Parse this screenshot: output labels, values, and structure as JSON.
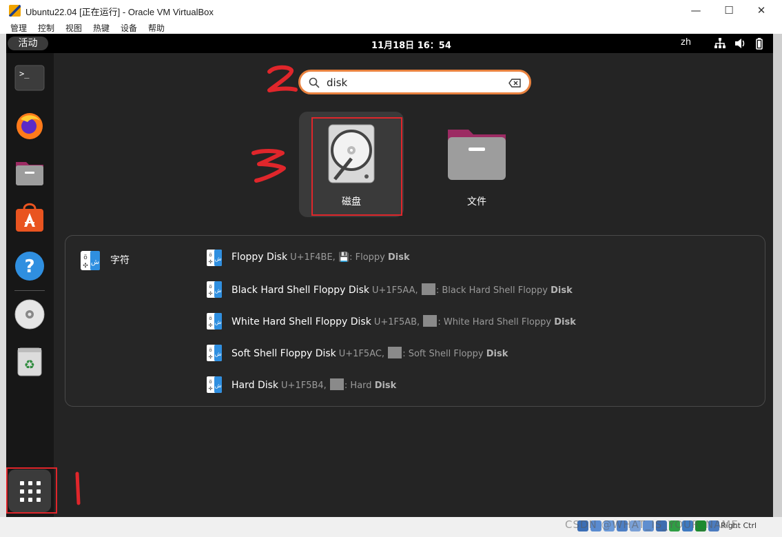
{
  "window": {
    "title": "Ubuntu22.04 [正在运行] - Oracle VM VirtualBox",
    "minimize": "—",
    "maximize": "☐",
    "close": "✕"
  },
  "menubar": [
    "管理",
    "控制",
    "视图",
    "热键",
    "设备",
    "帮助"
  ],
  "topbar": {
    "activities": "活动",
    "clock": "11月18日  16：54",
    "lang": "zh",
    "tray_icons": [
      "network-icon",
      "volume-icon",
      "battery-icon"
    ]
  },
  "dock": {
    "items": [
      "terminal-icon",
      "firefox-icon",
      "files-icon",
      "software-icon",
      "help-icon",
      "disc-icon",
      "trash-icon"
    ],
    "apps_button_icon": "app-grid-icon"
  },
  "search": {
    "value": "disk",
    "placeholder": ""
  },
  "apps": [
    {
      "label": "磁盘",
      "icon": "disks-icon",
      "selected": true
    },
    {
      "label": "文件",
      "icon": "files-folder-icon",
      "selected": false
    }
  ],
  "results": {
    "provider": "字符",
    "items": [
      {
        "name": "Floppy Disk",
        "code": "U+1F4BE,",
        "glyph": "💾",
        "desc_pre": ": Floppy ",
        "desc_bold": "Disk"
      },
      {
        "name": "Black Hard Shell Floppy Disk",
        "code": "U+1F5AA,",
        "glyph": "",
        "desc_pre": ": Black Hard Shell Floppy ",
        "desc_bold": "Disk"
      },
      {
        "name": "White Hard Shell Floppy Disk",
        "code": "U+1F5AB,",
        "glyph": "",
        "desc_pre": ": White Hard Shell Floppy ",
        "desc_bold": "Disk"
      },
      {
        "name": "Soft Shell Floppy Disk",
        "code": "U+1F5AC,",
        "glyph": "",
        "desc_pre": ": Soft Shell Floppy ",
        "desc_bold": "Disk"
      },
      {
        "name": "Hard Disk",
        "code": "U+1F5B4,",
        "glyph": "",
        "desc_pre": ": Hard ",
        "desc_bold": "Disk"
      }
    ]
  },
  "annotations": {
    "color": "#e0262b",
    "labels": [
      "1",
      "2",
      "3"
    ]
  },
  "statusbar": {
    "host_key": "Right Ctrl",
    "watermark": "CSDN @WHAT_IS_YOUR_NAME"
  },
  "colors": {
    "accent": "#e9823f",
    "panel": "#000000",
    "overview": "#242424",
    "annotation": "#e0262b"
  }
}
